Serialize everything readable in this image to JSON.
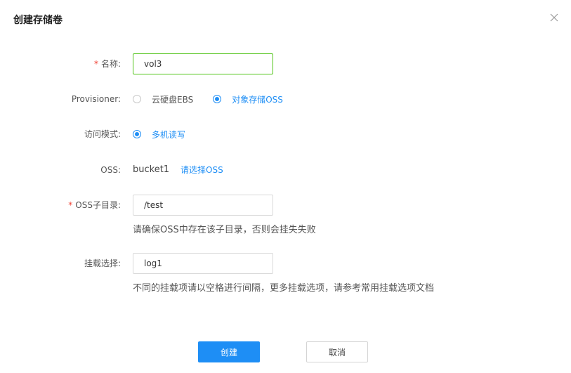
{
  "dialog": {
    "title": "创建存储卷",
    "close_icon": "close-icon"
  },
  "form": {
    "name": {
      "required": "*",
      "label": "名称:",
      "value": "vol3"
    },
    "provisioner": {
      "label": "Provisioner:",
      "options": [
        {
          "label": "云硬盘EBS",
          "checked": false
        },
        {
          "label": "对象存储OSS",
          "checked": true
        }
      ]
    },
    "access_mode": {
      "label": "访问模式:",
      "options": [
        {
          "label": "多机读写",
          "checked": true
        }
      ]
    },
    "oss": {
      "label": "OSS:",
      "value": "bucket1",
      "link": "请选择OSS"
    },
    "oss_subdir": {
      "required": "*",
      "label": "OSS子目录:",
      "value": "/test",
      "hint": "请确保OSS中存在该子目录，否则会挂失失败"
    },
    "mount_options": {
      "label": "挂载选择:",
      "value": "log1",
      "hint": "不同的挂载项请以空格进行间隔，更多挂载选项，请参考常用挂载选项文档"
    }
  },
  "footer": {
    "create_label": "创建",
    "cancel_label": "取消"
  },
  "colors": {
    "primary": "#1e8ef5",
    "required": "#f04134",
    "focus_border": "#52c41a"
  }
}
